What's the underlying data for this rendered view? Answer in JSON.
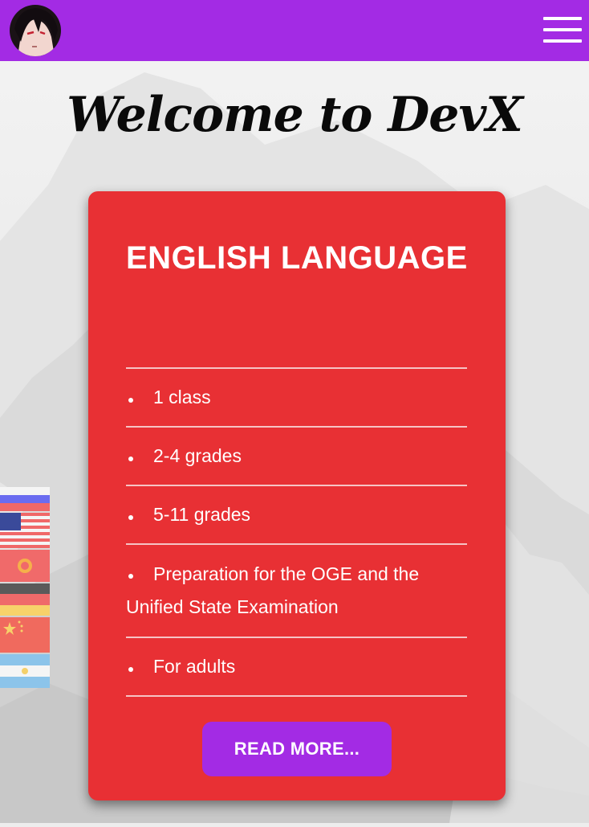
{
  "header": {
    "avatar_icon": "profile-avatar-icon",
    "menu_icon": "hamburger-menu-icon",
    "brand_color": "#a32be4"
  },
  "hero": {
    "title": "Welcome to DevX"
  },
  "card": {
    "title": "ENGLISH LANGUAGE",
    "accent_color": "#e83034",
    "items": [
      {
        "label": "1 class"
      },
      {
        "label": "2-4 grades"
      },
      {
        "label": "5-11 grades"
      },
      {
        "label": "Preparation for the OGE and the Unified State Examination"
      },
      {
        "label": "For adults"
      }
    ],
    "button_label": "READ MORE..."
  },
  "language_flags": [
    {
      "name": "russia-flag-icon"
    },
    {
      "name": "usa-flag-icon"
    },
    {
      "name": "kyrgyzstan-flag-icon"
    },
    {
      "name": "germany-flag-icon"
    },
    {
      "name": "china-flag-icon"
    },
    {
      "name": "argentina-flag-icon"
    }
  ]
}
